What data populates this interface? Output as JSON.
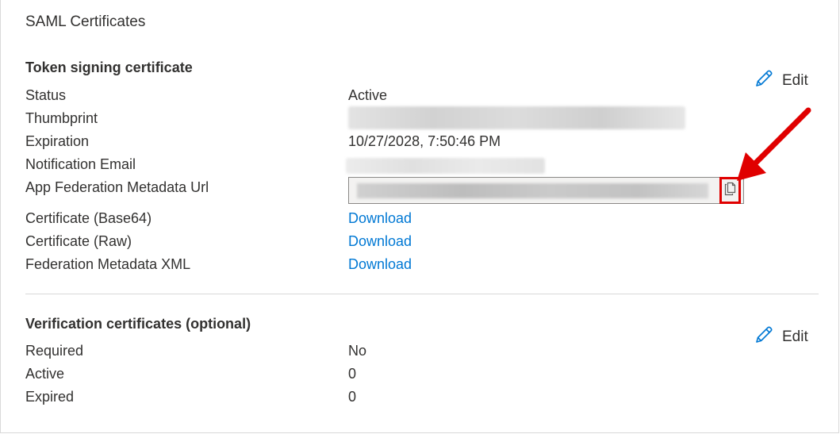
{
  "panel": {
    "title": "SAML Certificates"
  },
  "token_signing": {
    "title": "Token signing certificate",
    "edit_label": "Edit",
    "rows": [
      {
        "label": "Status",
        "value": "Active"
      },
      {
        "label": "Thumbprint",
        "value": ""
      },
      {
        "label": "Expiration",
        "value": "10/27/2028, 7:50:46 PM"
      },
      {
        "label": "Notification Email",
        "value": ""
      },
      {
        "label": "App Federation Metadata Url",
        "value": ""
      },
      {
        "label": "Certificate (Base64)",
        "value": "Download"
      },
      {
        "label": "Certificate (Raw)",
        "value": "Download"
      },
      {
        "label": "Federation Metadata XML",
        "value": "Download"
      }
    ]
  },
  "verification": {
    "title": "Verification certificates (optional)",
    "edit_label": "Edit",
    "rows": [
      {
        "label": "Required",
        "value": "No"
      },
      {
        "label": "Active",
        "value": "0"
      },
      {
        "label": "Expired",
        "value": "0"
      }
    ]
  },
  "icons": {
    "edit": "pencil-icon",
    "copy": "copy-icon",
    "annotation": "red-arrow-icon"
  },
  "colors": {
    "link": "#0078d4",
    "highlight": "#e00000",
    "text": "#323130"
  }
}
